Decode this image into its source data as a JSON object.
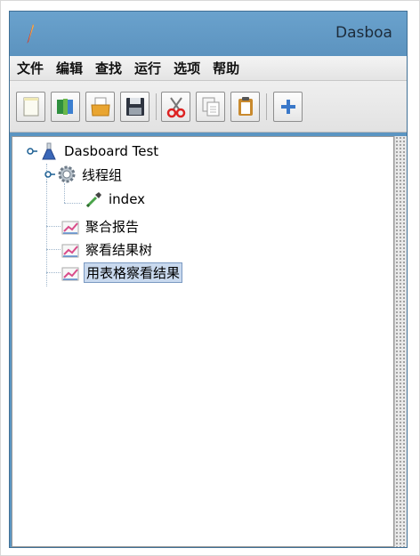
{
  "window": {
    "title": "Dasboa"
  },
  "menu": [
    {
      "label": "文件"
    },
    {
      "label": "编辑"
    },
    {
      "label": "查找"
    },
    {
      "label": "运行"
    },
    {
      "label": "选项"
    },
    {
      "label": "帮助"
    }
  ],
  "toolbar": {
    "buttons": [
      {
        "icon": "new-file-icon"
      },
      {
        "icon": "templates-book-icon"
      },
      {
        "icon": "open-folder-icon"
      },
      {
        "icon": "save-disk-icon"
      },
      {
        "icon": "cut-scissors-icon"
      },
      {
        "icon": "copy-icon"
      },
      {
        "icon": "paste-clipboard-icon"
      },
      {
        "icon": "expand-plus-icon"
      }
    ]
  },
  "tree": {
    "root": {
      "label": "Dasboard Test",
      "icon": "test-plan-flask-icon"
    },
    "thread_group": {
      "label": "线程组",
      "icon": "gear-icon"
    },
    "sampler": {
      "label": "index",
      "icon": "pipette-sampler-icon"
    },
    "listeners": [
      {
        "label": "聚合报告",
        "icon": "listener-graph-icon"
      },
      {
        "label": "察看结果树",
        "icon": "listener-graph-icon"
      },
      {
        "label": "用表格察看结果",
        "icon": "listener-graph-icon",
        "selected": true
      }
    ]
  },
  "colors": {
    "titlebar": "#5b95c2",
    "selection": "#c9d9ee"
  }
}
